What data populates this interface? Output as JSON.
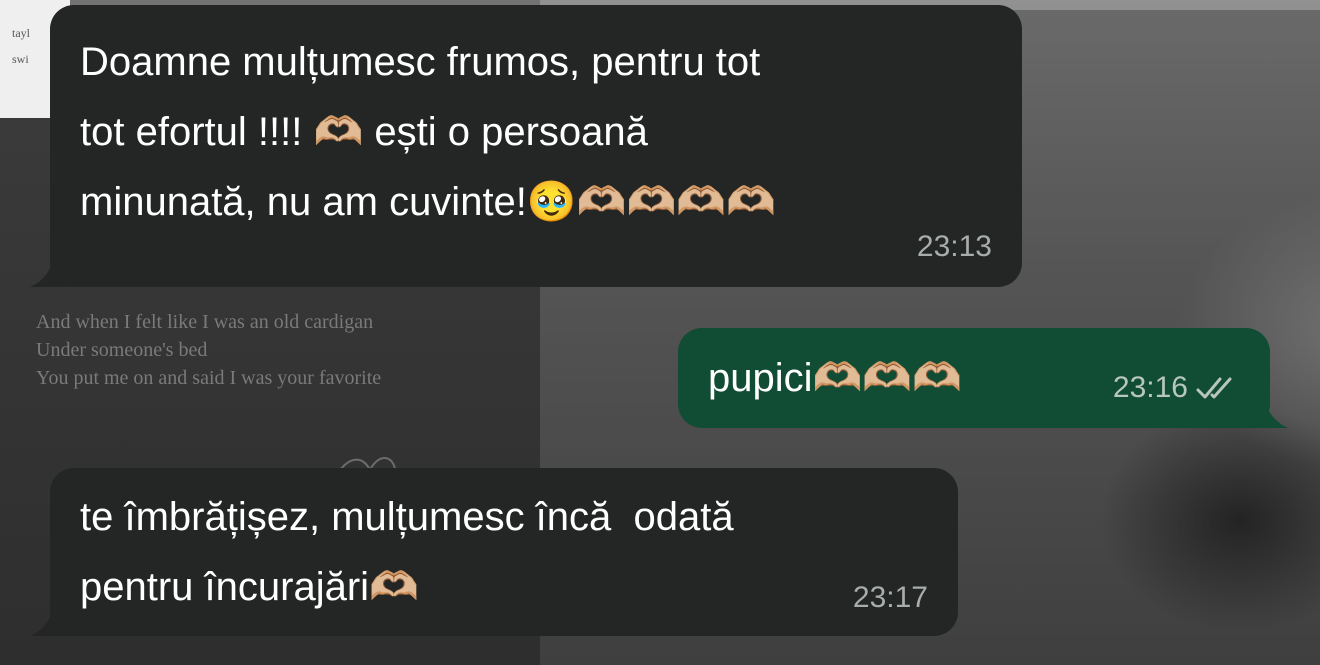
{
  "wallpaper": {
    "note_lines": [
      "tayl",
      "swi"
    ],
    "lyrics": [
      "And when I felt like I was an old cardigan",
      "Under someone's bed",
      "You put me on and said I was your favorite"
    ]
  },
  "messages": [
    {
      "direction": "incoming",
      "text": "Doamne mulțumesc frumos, pentru tot\ntot efortul !!!! 🫶🏼 ești o persoană\nminunată, nu am cuvinte!🥹🫶🏼🫶🏼🫶🏼🫶🏼",
      "time": "23:13"
    },
    {
      "direction": "outgoing",
      "text": "pupici🫶🏼🫶🏼🫶🏼",
      "time": "23:16",
      "status_icon": "double-check-icon"
    },
    {
      "direction": "incoming",
      "text": "te îmbrățișez, mulțumesc încă  odată\npentru încurajări🫶🏼",
      "time": "23:17"
    }
  ],
  "colors": {
    "incoming_bubble": "#232625",
    "outgoing_bubble": "#114c35",
    "timestamp": "#a8adab"
  }
}
